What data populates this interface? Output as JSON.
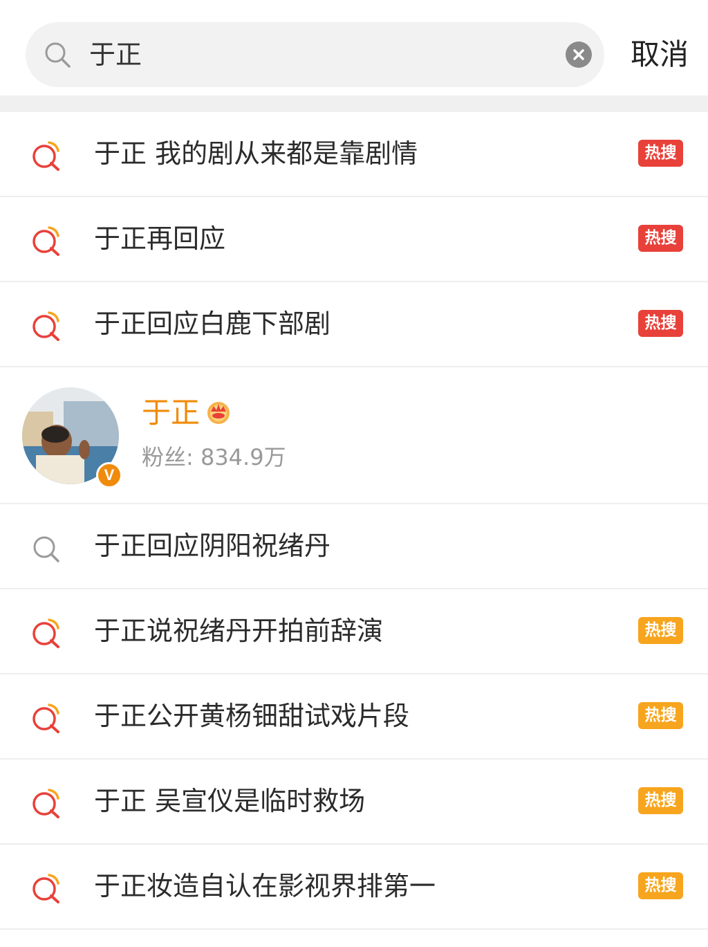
{
  "search": {
    "query": "于正",
    "cancel_label": "取消"
  },
  "suggestions_top": [
    {
      "text": "于正 我的剧从来都是靠剧情",
      "badge": "热搜",
      "badge_color": "#e8413a",
      "icon": "hot-search-icon"
    },
    {
      "text": "于正再回应",
      "badge": "热搜",
      "badge_color": "#e8413a",
      "icon": "hot-search-icon"
    },
    {
      "text": "于正回应白鹿下部剧",
      "badge": "热搜",
      "badge_color": "#e8413a",
      "icon": "hot-search-icon"
    }
  ],
  "user": {
    "name": "于正",
    "fans": "粉丝: 834.9万",
    "verified_badge": "V",
    "name_color": "#f08b0c"
  },
  "suggestions_bottom": [
    {
      "text": "于正回应阴阳祝绪丹",
      "badge": "",
      "icon": "search-icon"
    },
    {
      "text": "于正说祝绪丹开拍前辞演",
      "badge": "热搜",
      "badge_color": "#f7a51e",
      "icon": "hot-search-icon"
    },
    {
      "text": "于正公开黄杨钿甜试戏片段",
      "badge": "热搜",
      "badge_color": "#f7a51e",
      "icon": "hot-search-icon"
    },
    {
      "text": "于正 吴宣仪是临时救场",
      "badge": "热搜",
      "badge_color": "#f7a51e",
      "icon": "hot-search-icon"
    },
    {
      "text": "于正妆造自认在影视界排第一",
      "badge": "热搜",
      "badge_color": "#f7a51e",
      "icon": "hot-search-icon"
    }
  ]
}
